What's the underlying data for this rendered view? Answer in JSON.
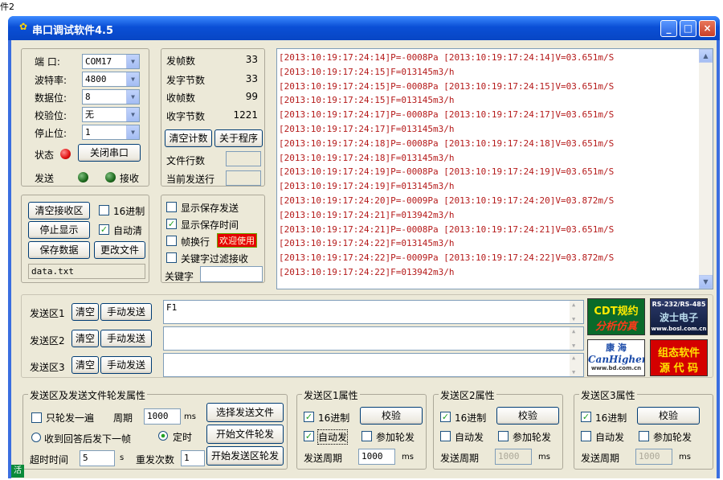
{
  "outer_title": "件2",
  "window": {
    "title": "串口调试软件4.5",
    "min_label": "_",
    "max_label": "□",
    "close_label": "×"
  },
  "port": {
    "port_label": "端  口:",
    "port_value": "COM17",
    "baud_label": "波特率:",
    "baud_value": "4800",
    "databits_label": "数据位:",
    "databits_value": "8",
    "parity_label": "校验位:",
    "parity_value": "无",
    "stopbits_label": "停止位:",
    "stopbits_value": "1",
    "status_label": "状态",
    "close_port_button": "关闭串口",
    "send_label": "发送",
    "recv_label": "接收"
  },
  "stats": {
    "tx_frames_label": "发帧数",
    "tx_frames": "33",
    "tx_bytes_label": "发字节数",
    "tx_bytes": "33",
    "rx_frames_label": "收帧数",
    "rx_frames": "99",
    "rx_bytes_label": "收字节数",
    "rx_bytes": "1221",
    "clear_count_button": "清空计数",
    "about_button": "关于程序",
    "file_lines_label": "文件行数",
    "current_line_label": "当前发送行"
  },
  "recv": {
    "clear_button": "清空接收区",
    "hex_label": "16进制",
    "stop_button": "停止显示",
    "autoclear_label": "自动清",
    "save_button": "保存数据",
    "change_file_button": "更改文件",
    "filename": "data.txt"
  },
  "options": {
    "show_save_send": "显示保存发送",
    "show_save_time": "显示保存时间",
    "frame_newline": "帧换行",
    "welcome_badge": "欢迎使用",
    "keyword_filter": "关键字过滤接收",
    "keyword_label": "关键字"
  },
  "log_lines": [
    "[2013:10:19:17:24:14]P=-0008Pa [2013:10:19:17:24:14]V=03.651m/S",
    "[2013:10:19:17:24:15]F=013145m3/h",
    "[2013:10:19:17:24:15]P=-0008Pa [2013:10:19:17:24:15]V=03.651m/S",
    "[2013:10:19:17:24:15]F=013145m3/h",
    "[2013:10:19:17:24:17]P=-0008Pa [2013:10:19:17:24:17]V=03.651m/S",
    "[2013:10:19:17:24:17]F=013145m3/h",
    "[2013:10:19:17:24:18]P=-0008Pa [2013:10:19:17:24:18]V=03.651m/S",
    "[2013:10:19:17:24:18]F=013145m3/h",
    "[2013:10:19:17:24:19]P=-0008Pa [2013:10:19:17:24:19]V=03.651m/S",
    "[2013:10:19:17:24:19]F=013145m3/h",
    "[2013:10:19:17:24:20]P=-0009Pa [2013:10:19:17:24:20]V=03.872m/S",
    "[2013:10:19:17:24:21]F=013942m3/h",
    "[2013:10:19:17:24:21]P=-0008Pa [2013:10:19:17:24:21]V=03.651m/S",
    "[2013:10:19:17:24:22]F=013145m3/h",
    "[2013:10:19:17:24:22]P=-0009Pa [2013:10:19:17:24:22]V=03.872m/S",
    "[2013:10:19:17:24:22]F=013942m3/h"
  ],
  "send": {
    "area1_label": "发送区1",
    "area2_label": "发送区2",
    "area3_label": "发送区3",
    "clear_label": "清空",
    "manual_label": "手动发送",
    "area1_text": "F1"
  },
  "ads": {
    "cdt_line1": "CDT规约",
    "cdt_line2": "分析仿真",
    "rs_line1": "RS-232/RS-485",
    "rs_line2": "波士电子",
    "rs_line3": "www.bosl.com.cn",
    "kh_line1": "康  海",
    "kh_line2": "CanHigher",
    "kh_line3": "www.bd.com.cn",
    "zt_line1": "组态软件",
    "zt_line2": "源 代 码"
  },
  "rotation": {
    "title": "发送区及发送文件轮发属性",
    "only_once": "只轮发一遍",
    "period_label": "周期",
    "period_value": "1000",
    "ms": "ms",
    "select_file_button": "选择发送文件",
    "reply_next": "收到回答后发下一帧",
    "timed": "定时",
    "start_file_button": "开始文件轮发",
    "timeout_label": "超时时间",
    "timeout_value": "5",
    "s": "s",
    "retry_label": "重发次数",
    "retry_value": "1",
    "start_area_button": "开始发送区轮发"
  },
  "area_props": [
    {
      "title": "发送区1属性",
      "hex": "16进制",
      "check": "校验",
      "auto": "自动发",
      "join": "参加轮发",
      "period_label": "发送周期",
      "period_value": "1000",
      "ms": "ms"
    },
    {
      "title": "发送区2属性",
      "hex": "16进制",
      "check": "校验",
      "auto": "自动发",
      "join": "参加轮发",
      "period_label": "发送周期",
      "period_value": "1000",
      "ms": "ms"
    },
    {
      "title": "发送区3属性",
      "hex": "16进制",
      "check": "校验",
      "auto": "自动发",
      "join": "参加轮发",
      "period_label": "发送周期",
      "period_value": "1000",
      "ms": "ms"
    }
  ],
  "status_badge": "活",
  "colors": {
    "titlebar": "#0a4fd6",
    "log_text": "#b51a1a",
    "led_red": "#e01010",
    "led_green": "#1d6a1d",
    "client_bg": "#ece9d8"
  }
}
